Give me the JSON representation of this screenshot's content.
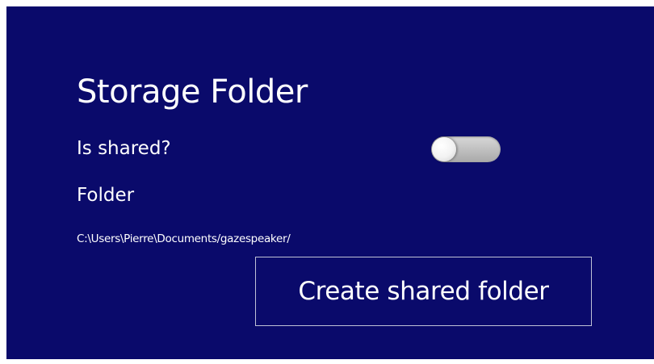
{
  "settings_panel": {
    "title": "Storage Folder",
    "is_shared_label": "Is shared?",
    "is_shared_toggle": {
      "checked": false
    },
    "folder_label": "Folder",
    "folder_path": "C:\\Users\\Pierre\\Documents/gazespeaker/",
    "create_button_label": "Create shared folder"
  },
  "colors": {
    "background": "#0a0a6b",
    "text": "#ffffff",
    "button_border": "#bfc2d6",
    "toggle_track": "#b8b8b8",
    "toggle_knob": "#f5f5f5"
  }
}
